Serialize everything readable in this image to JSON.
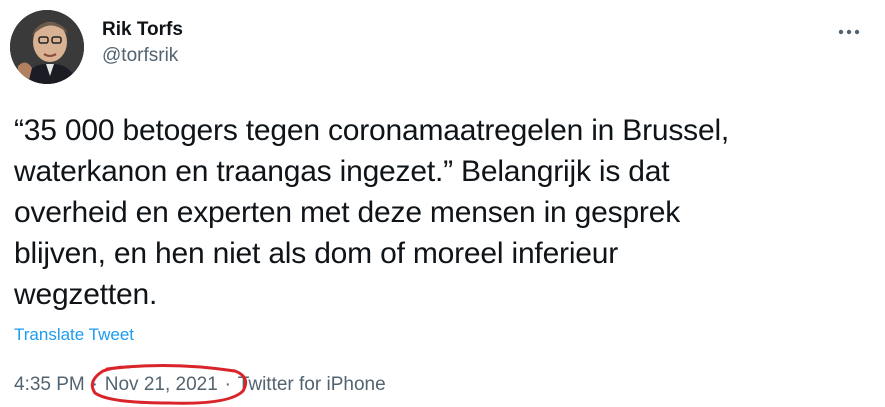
{
  "author": {
    "display_name": "Rik Torfs",
    "handle": "@torfsrik"
  },
  "tweet": {
    "text": "“35 000 betogers tegen coronamaatregelen in Brussel,\nwaterkanon en traangas ingezet.” Belangrijk is dat\noverheid en experten met deze mensen in gesprek\nblijven, en hen niet als dom of moreel inferieur\nwegzetten.",
    "translate_label": "Translate Tweet"
  },
  "meta": {
    "time": "4:35 PM",
    "separator": "·",
    "date": "Nov 21, 2021",
    "source": "Twitter for iPhone"
  },
  "icons": {
    "more": "more-options-icon"
  },
  "colors": {
    "link": "#1d9bf0",
    "secondary_text": "#536471",
    "annotation": "#d9252a"
  }
}
